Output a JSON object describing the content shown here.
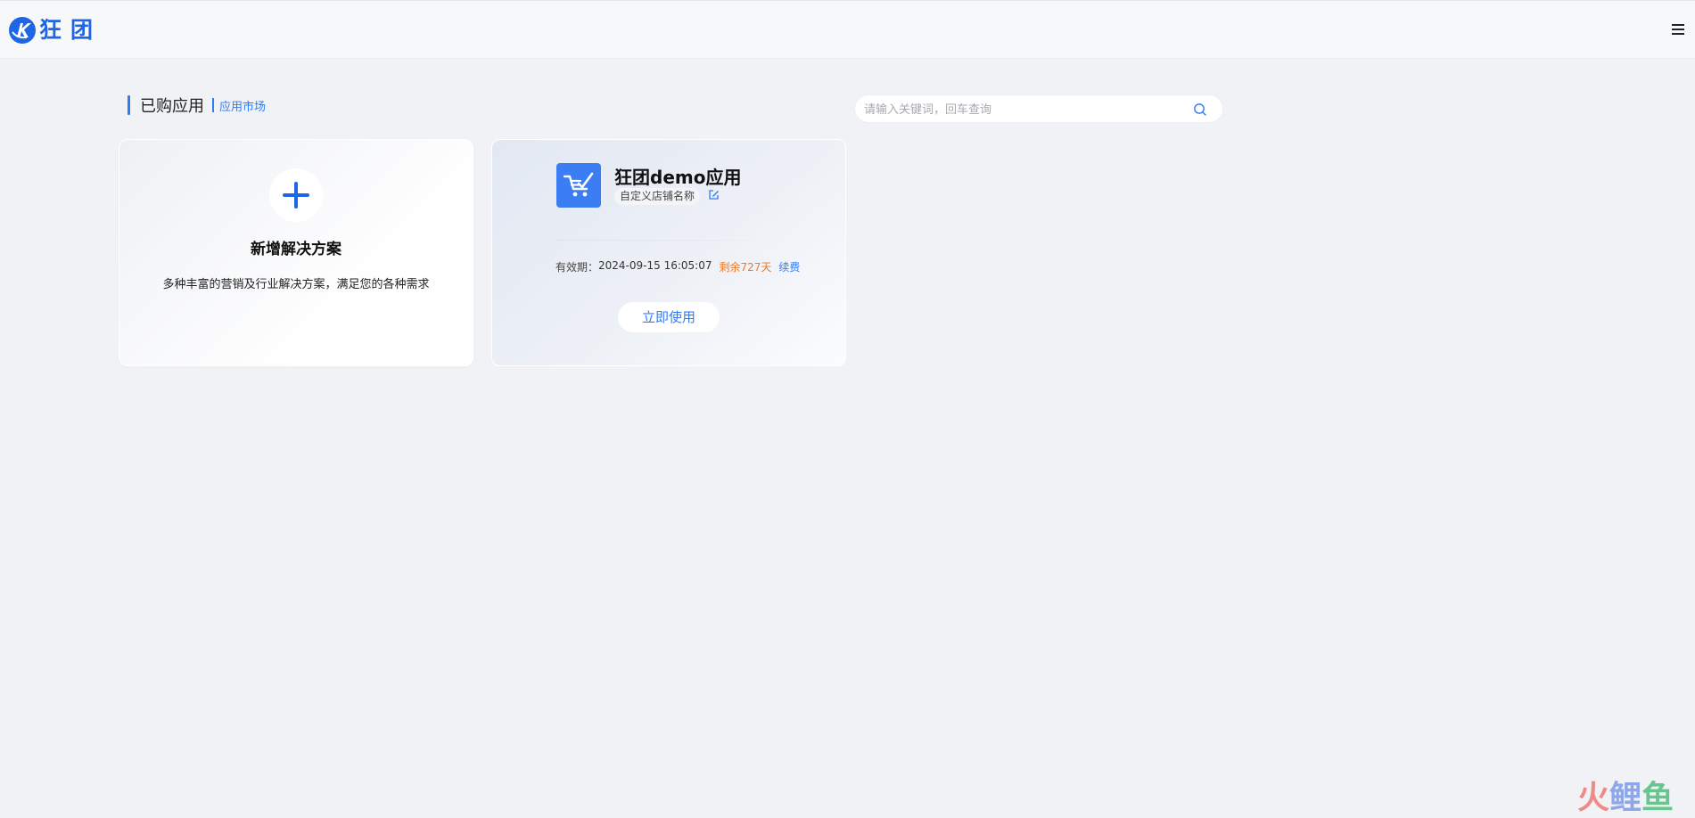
{
  "header": {
    "logo_text": "狂团",
    "logo_icon": "kuangtuan-logo-icon",
    "menu_icon": "hamburger-menu-icon"
  },
  "section": {
    "title": "已购应用",
    "market_link": "应用市场"
  },
  "search": {
    "placeholder": "请输入关键词，回车查询",
    "value": "",
    "icon": "search-icon"
  },
  "add_card": {
    "icon": "plus-icon",
    "title": "新增解决方案",
    "description": "多种丰富的营销及行业解决方案，满足您的各种需求"
  },
  "app_card": {
    "icon": "shopping-cart-icon",
    "name": "狂团demo应用",
    "store_name": "自定义店铺名称",
    "edit_icon": "edit-icon",
    "expiry_label": "有效期：",
    "expiry_date": "2024-09-15 16:05:07",
    "remaining": "剩余727天",
    "renew_label": "续费",
    "use_button": "立即使用"
  },
  "watermark": {
    "char1": "火",
    "char2": "鲤",
    "char3": "鱼"
  },
  "colors": {
    "accent": "#2f7cf6",
    "brand": "#1f66e5",
    "remaining": "#ee7a26",
    "background": "#f0f2f6"
  }
}
